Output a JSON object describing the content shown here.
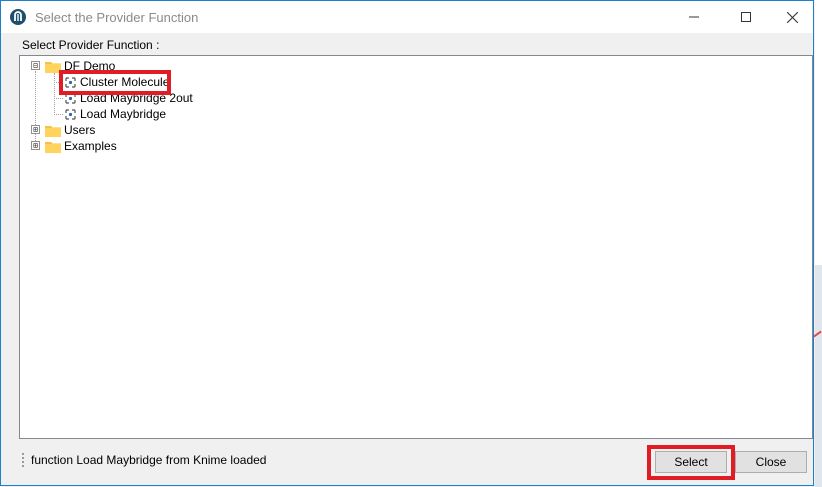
{
  "window": {
    "title": "Select the Provider Function",
    "controls": {
      "minimize": "minimize-icon",
      "maximize": "maximize-icon",
      "close": "close-icon"
    }
  },
  "prompt_label": "Select Provider Function :",
  "tree": {
    "root": {
      "label": "DF Demo",
      "expander": "⊟",
      "children": [
        {
          "label": "Cluster Molecule",
          "highlighted": true
        },
        {
          "label": "Load Maybridge 2out"
        },
        {
          "label": "Load Maybridge"
        }
      ]
    },
    "folders": [
      {
        "label": "Users",
        "expander": "⊞"
      },
      {
        "label": "Examples",
        "expander": "⊞"
      }
    ]
  },
  "status": {
    "text": "function Load Maybridge from Knime loaded"
  },
  "buttons": {
    "select": "Select",
    "close": "Close"
  },
  "colors": {
    "highlight": "#e01c24",
    "folder": "#f5c242",
    "window_border": "#1f7fc8",
    "app_icon": "#1d4f6e"
  }
}
